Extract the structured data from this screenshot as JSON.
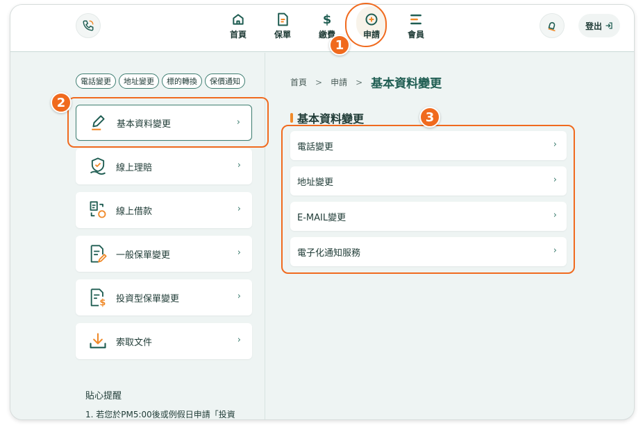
{
  "header": {
    "nav": [
      {
        "label": "首頁",
        "icon": "home-icon"
      },
      {
        "label": "保單",
        "icon": "document-icon"
      },
      {
        "label": "繳費",
        "icon": "dollar-icon"
      },
      {
        "label": "申請",
        "icon": "plus-circle-icon",
        "active": true
      },
      {
        "label": "會員",
        "icon": "menu-lines-icon"
      }
    ],
    "logout_label": "登出"
  },
  "sidebar": {
    "chips": [
      "電話變更",
      "地址變更",
      "標的轉換",
      "保價通知"
    ],
    "menu": [
      {
        "label": "基本資料變更",
        "icon": "pen-icon",
        "active": true
      },
      {
        "label": "線上理賠",
        "icon": "shield-hand-icon"
      },
      {
        "label": "線上借款",
        "icon": "loan-exchange-icon"
      },
      {
        "label": "一般保單變更",
        "icon": "document-edit-icon"
      },
      {
        "label": "投資型保單變更",
        "icon": "document-dollar-icon"
      },
      {
        "label": "索取文件",
        "icon": "download-icon"
      }
    ],
    "tips_title": "貼心提醒",
    "tips_line": "1. 若您於PM5:00後或例假日申請「投資"
  },
  "content": {
    "breadcrumb": [
      "首頁",
      "申請",
      "基本資料變更"
    ],
    "breadcrumb_sep": ">",
    "section_title": "基本資料變更",
    "items": [
      "電話變更",
      "地址變更",
      "E-MAIL變更",
      "電子化通知服務"
    ]
  },
  "chevron": "›",
  "callouts": [
    "1",
    "2",
    "3"
  ],
  "colors": {
    "primary": "#1f5d52",
    "accent": "#f06a1e",
    "background": "#eef4f3"
  }
}
